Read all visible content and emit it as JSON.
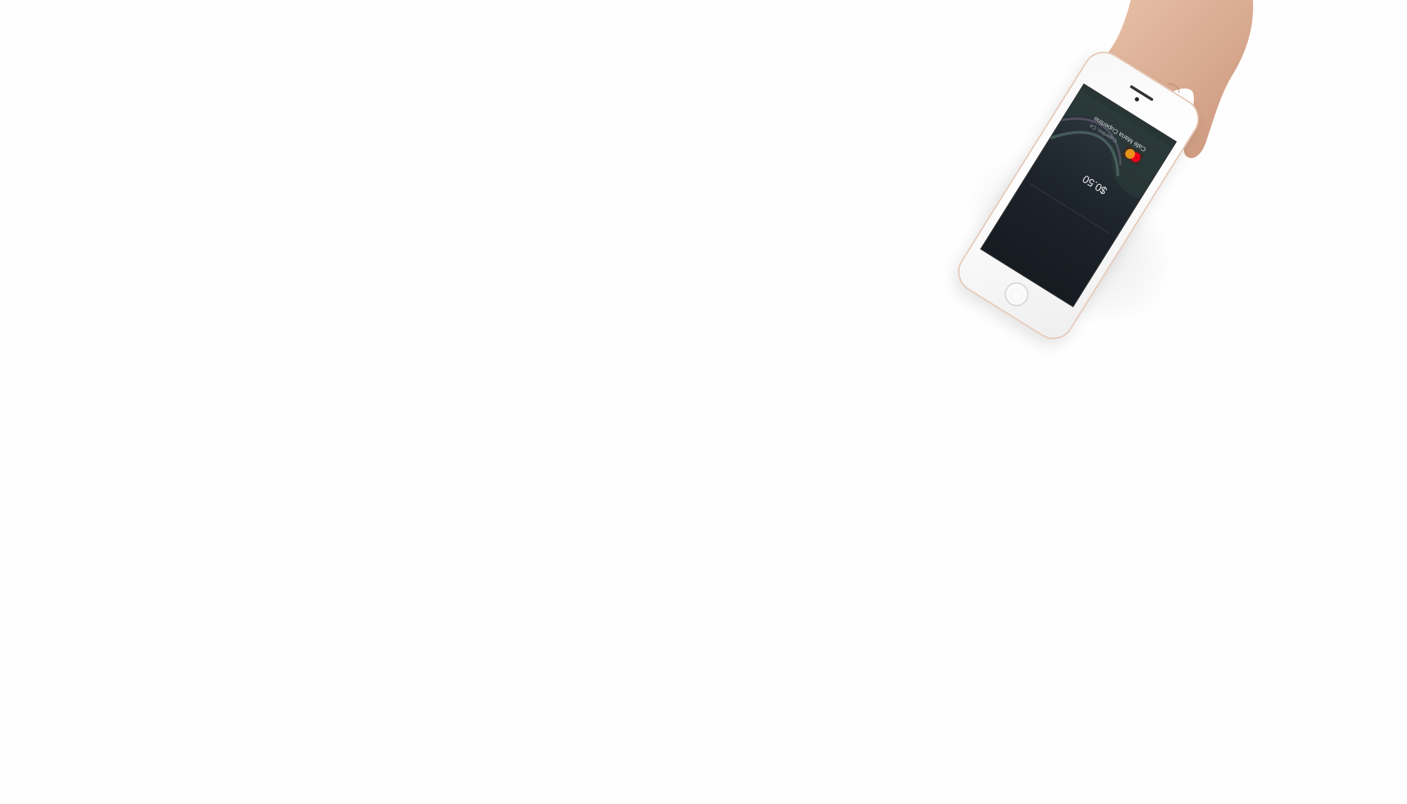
{
  "scene": {
    "background_color": "#fefefe"
  },
  "phone": {
    "screen": {
      "merchant_name": "Café Maria Cupertino",
      "location": "Cupertino, CA",
      "amount": "$0.50",
      "card_brand": "mastercard-icon"
    },
    "frame_color": "#f7f7f7",
    "accent_color": "#e7c9b8"
  }
}
